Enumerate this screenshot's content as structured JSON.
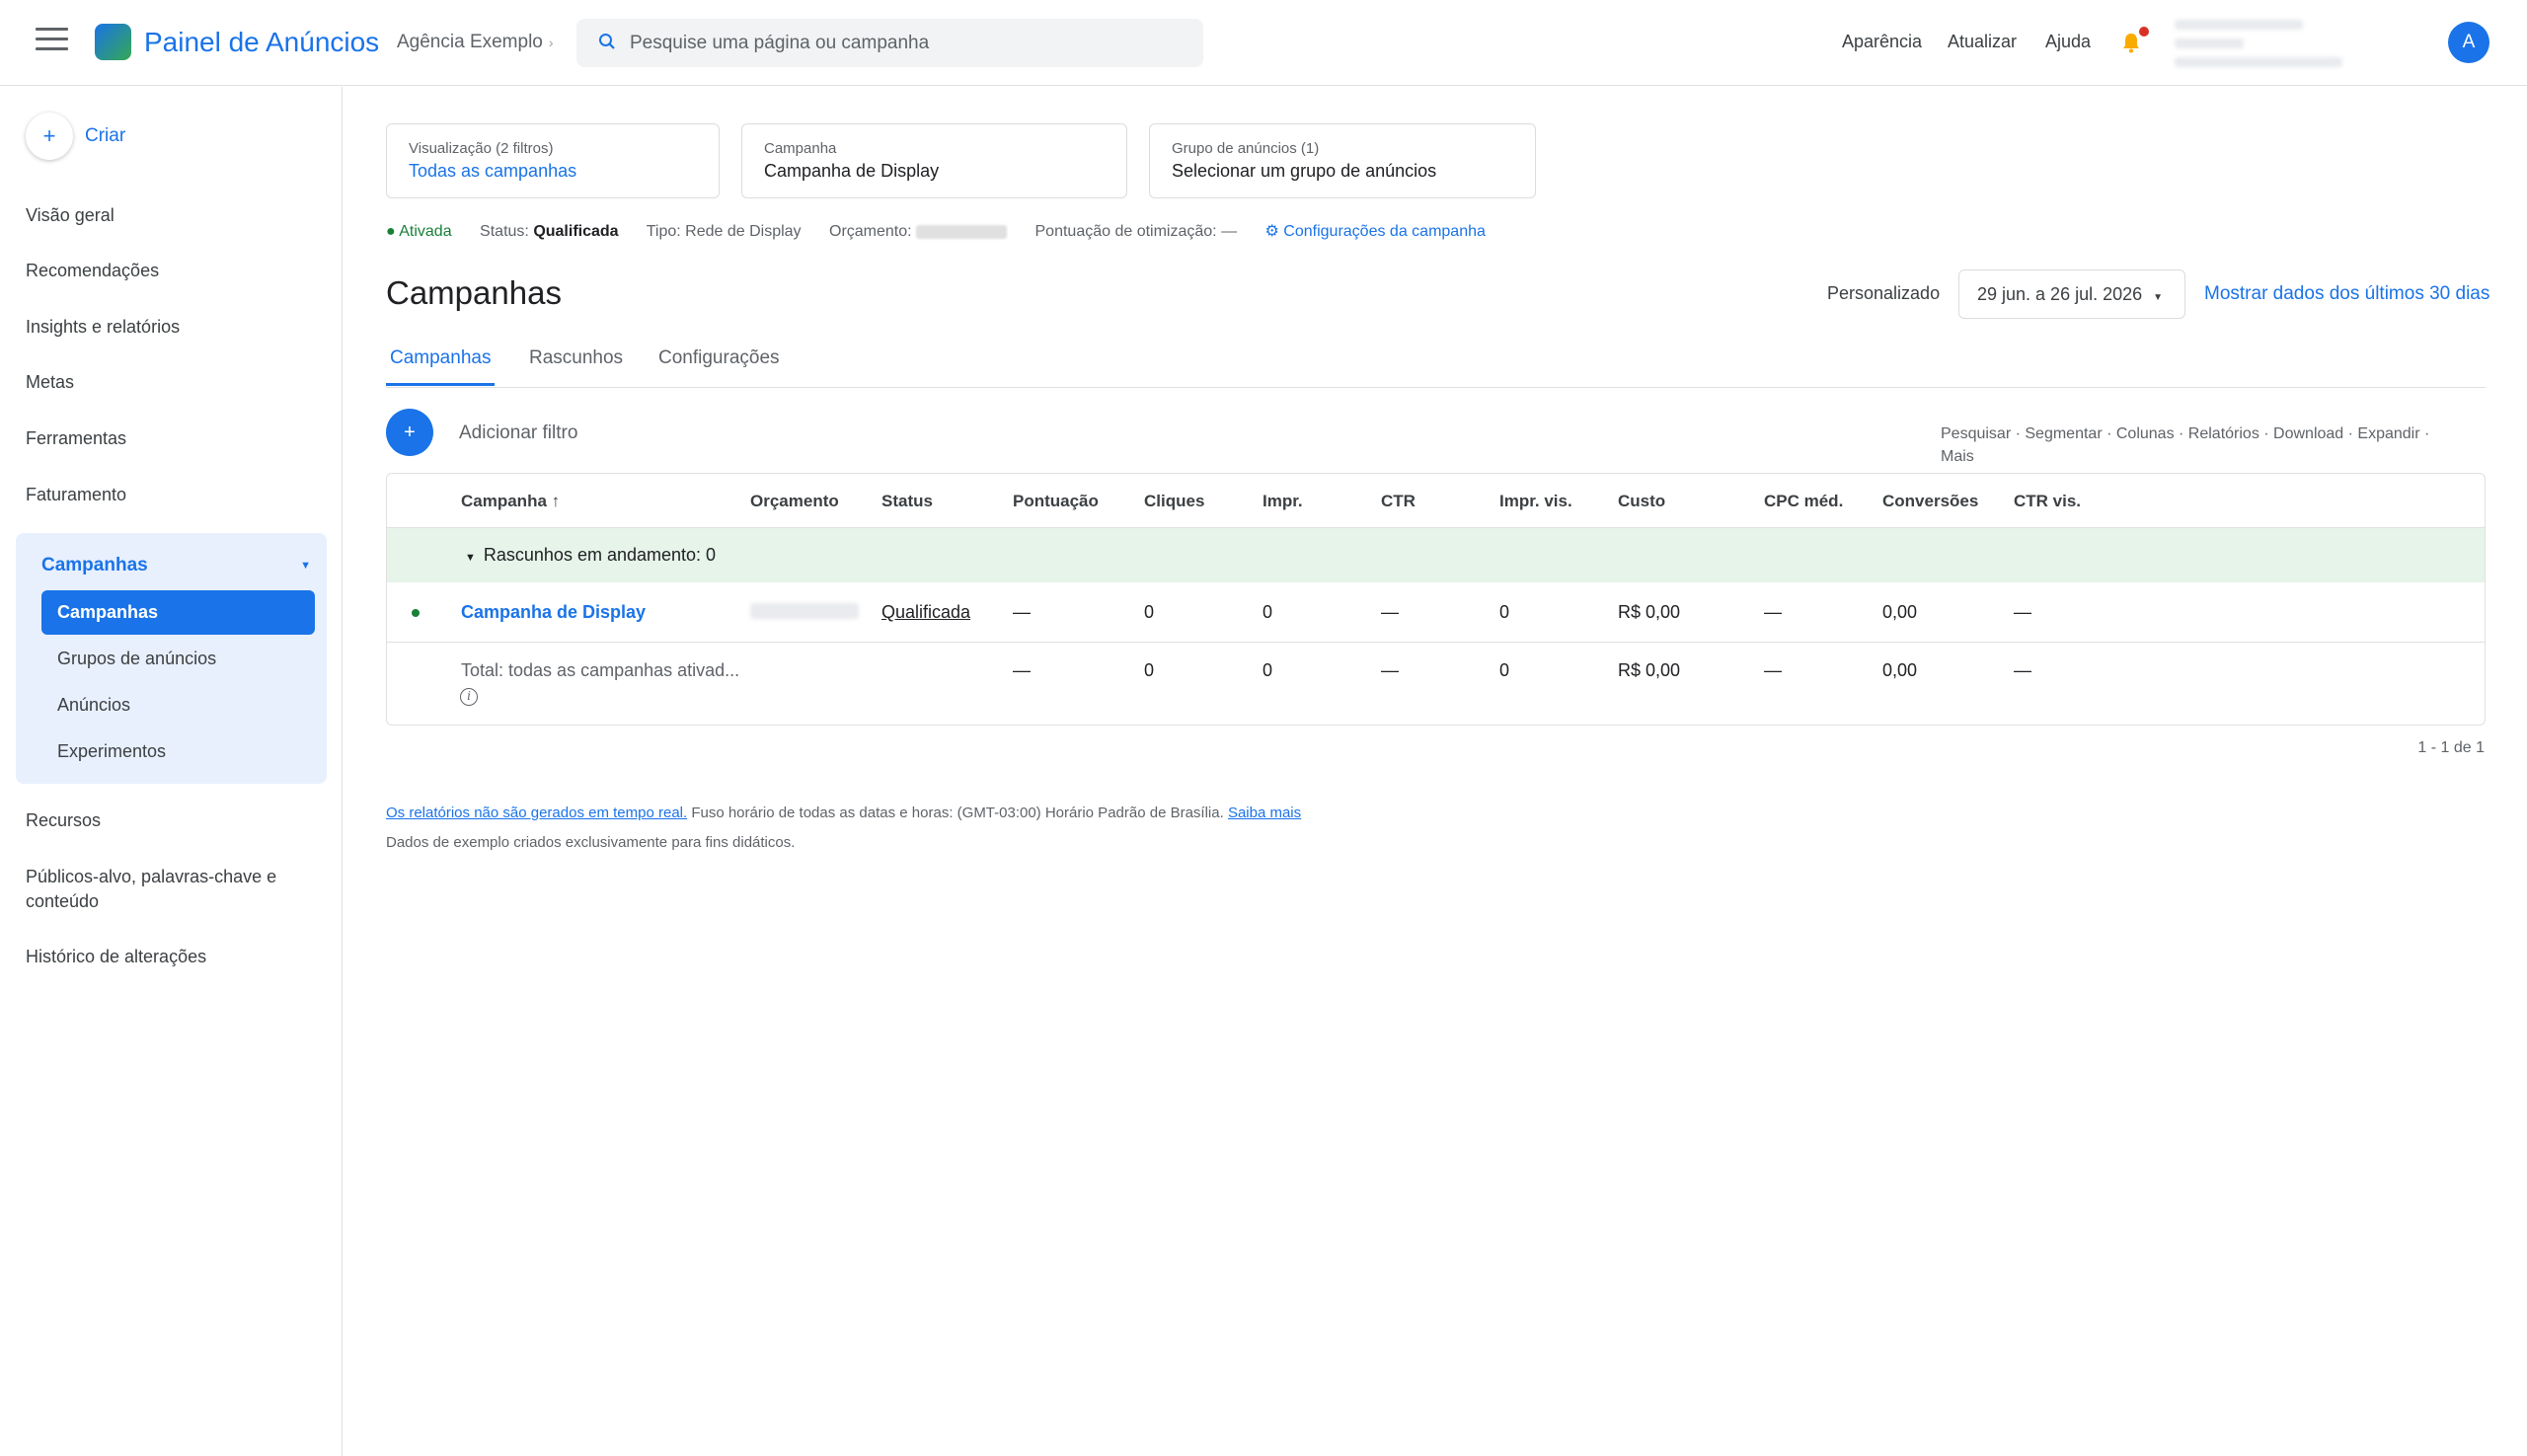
{
  "header": {
    "brand": "Painel de Anúncios",
    "agency": "Agência Exemplo",
    "search_placeholder": "Pesquise uma página ou campanha",
    "links": [
      "Aparência",
      "Atualizar",
      "Ajuda"
    ],
    "avatar_letter": "A"
  },
  "sidebar": {
    "create_label": "Criar",
    "items_top": [
      "Visão geral",
      "Recomendações",
      "Insights e relatórios",
      "Metas",
      "Ferramentas",
      "Faturamento"
    ],
    "group_title": "Campanhas",
    "group_items": [
      "Campanhas",
      "Grupos de anúncios",
      "Anúncios",
      "Experimentos"
    ],
    "items_bottom": [
      "Recursos",
      "Públicos-alvo, palavras-chave e conteúdo",
      "Histórico de alterações"
    ]
  },
  "selectors": [
    {
      "caption": "Visualização (2 filtros)",
      "value": "Todas as campanhas"
    },
    {
      "caption": "Campanha",
      "value": "Campanha de Display"
    },
    {
      "caption": "Grupo de anúncios (1)",
      "value": "Selecionar um grupo de anúncios"
    }
  ],
  "status_bar": {
    "enabled": "● Ativada",
    "status_label": "Status:",
    "status_value": "Qualificada",
    "type": "Tipo: Rede de Display",
    "budget_label": "Orçamento:",
    "opt_score": "Pontuação de otimização: —",
    "settings_link": "⚙ Configurações da campanha"
  },
  "page": {
    "title": "Campanhas",
    "date_label": "Personalizado",
    "date_range": "29 jun. a 26 jul. 2026",
    "last30_link": "Mostrar dados dos últimos 30 dias"
  },
  "tabs": [
    "Campanhas",
    "Rascunhos",
    "Configurações"
  ],
  "toolbar": {
    "add_filter": "Adicionar filtro",
    "tools": [
      "Pesquisar",
      "Segmentar",
      "Colunas",
      "Relatórios",
      "Download",
      "Expandir",
      "Mais"
    ]
  },
  "table": {
    "columns": [
      "Campanha ↑",
      "Orçamento",
      "Status",
      "Pontuação",
      "Cliques",
      "Impr.",
      "CTR",
      "Impr. vis.",
      "Custo",
      "CPC méd.",
      "Conversões",
      "CTR vis."
    ],
    "drafts": "Rascunhos em andamento: 0",
    "row": {
      "campaign": "Campanha de Display",
      "status": "Qualificada",
      "score": "—",
      "clicks": "0",
      "impr": "0",
      "ctr": "—",
      "vis_impr": "0",
      "cost": "R$ 0,00",
      "cpc": "—",
      "conv": "0,00",
      "vis_ctr": "—"
    },
    "total": {
      "label": "Total: todas as campanhas ativad...",
      "score": "—",
      "clicks": "0",
      "impr": "0",
      "ctr": "—",
      "vis_impr": "0",
      "cost": "R$ 0,00",
      "cpc": "—",
      "conv": "0,00",
      "vis_ctr": "—"
    },
    "pagination": "1 - 1 de 1"
  },
  "footer": {
    "link1": "Os relatórios não são gerados em tempo real.",
    "timezone": " Fuso horário de todas as datas e horas: (GMT-03:00) Horário Padrão de Brasília. ",
    "link2": "Saiba mais",
    "note": "Dados de exemplo criados exclusivamente para fins didáticos."
  }
}
